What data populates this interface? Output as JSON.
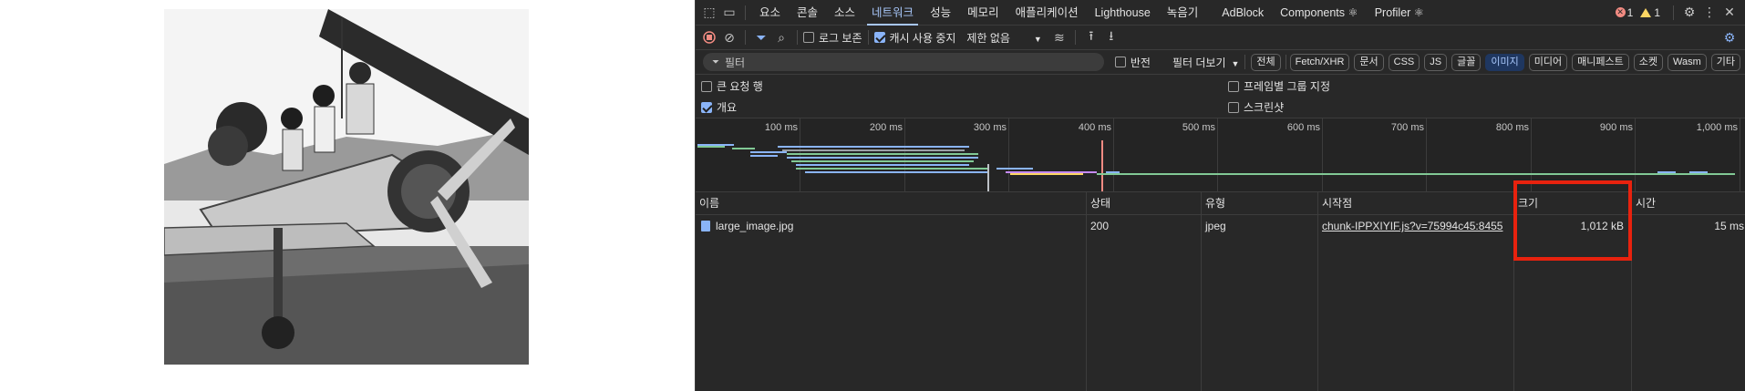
{
  "toolbar": {
    "tabs": [
      "요소",
      "콘솔",
      "소스",
      "네트워크",
      "성능",
      "메모리",
      "애플리케이션",
      "Lighthouse",
      "녹음기",
      "AdBlock",
      "Components ⚛",
      "Profiler ⚛"
    ],
    "active_tab": "네트워크",
    "error_count": "1",
    "warning_count": "1"
  },
  "network_toolbar": {
    "preserve_log": "로그 보존",
    "disable_cache": "캐시 사용 중지",
    "throttle": "제한 없음"
  },
  "filter_bar": {
    "placeholder": "필터",
    "invert": "반전",
    "more_filters": "필터 더보기",
    "chips": [
      "전체",
      "Fetch/XHR",
      "문서",
      "CSS",
      "JS",
      "글꼴",
      "이미지",
      "미디어",
      "매니페스트",
      "소켓",
      "Wasm",
      "기타"
    ],
    "active_chip": "이미지"
  },
  "options": {
    "large_rows": "큰 요청 행",
    "overview": "개요",
    "group_by_frame": "프레임별 그룹 지정",
    "screenshots": "스크린샷"
  },
  "timeline": {
    "ticks": [
      "100 ms",
      "200 ms",
      "300 ms",
      "400 ms",
      "500 ms",
      "600 ms",
      "700 ms",
      "800 ms",
      "900 ms",
      "1,000 ms"
    ]
  },
  "table": {
    "headers": {
      "name": "이름",
      "status": "상태",
      "type": "유형",
      "initiator": "시작점",
      "size": "크기",
      "time": "시간"
    },
    "rows": [
      {
        "name": "large_image.jpg",
        "status": "200",
        "type": "jpeg",
        "initiator": "chunk-IPPXIYIF.js?v=75994c45:8455",
        "size": "1,012 kB",
        "time": "15 ms"
      }
    ]
  },
  "colors": {
    "accent": "#a8c7fa",
    "highlight": "#e8220e",
    "background": "#282828"
  }
}
